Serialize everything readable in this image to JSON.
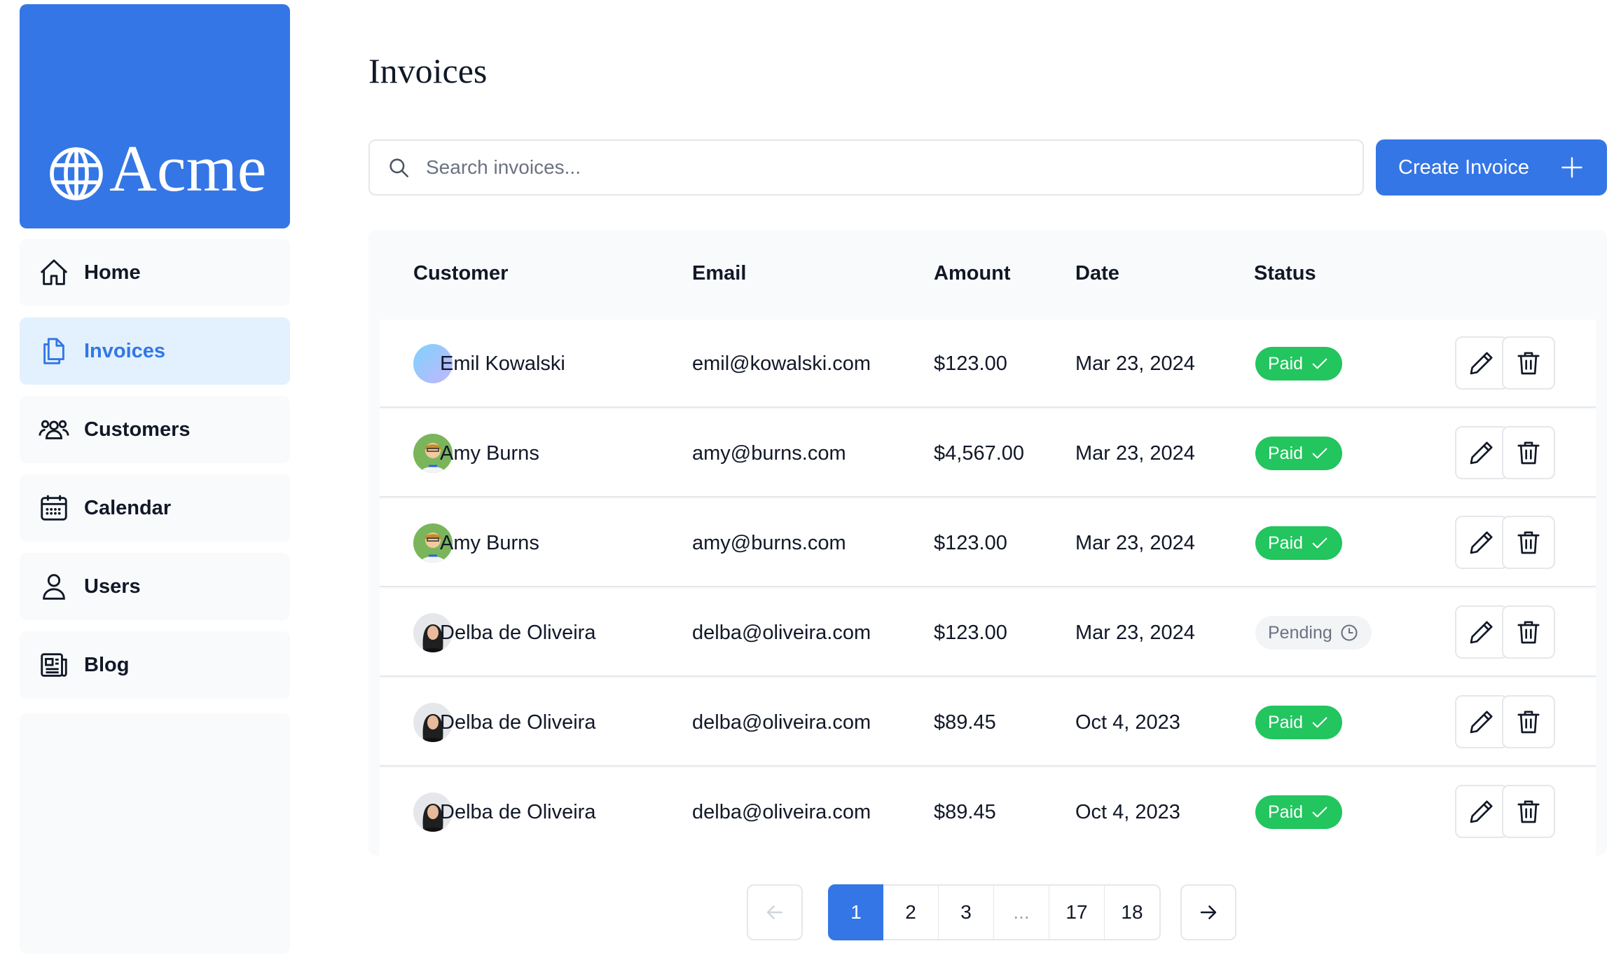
{
  "brand": {
    "name": "Acme"
  },
  "sidebar": {
    "items": [
      {
        "label": "Home",
        "icon": "home-icon",
        "active": false
      },
      {
        "label": "Invoices",
        "icon": "document-icon",
        "active": true
      },
      {
        "label": "Customers",
        "icon": "users-group-icon",
        "active": false
      },
      {
        "label": "Calendar",
        "icon": "calendar-icon",
        "active": false
      },
      {
        "label": "Users",
        "icon": "user-icon",
        "active": false
      },
      {
        "label": "Blog",
        "icon": "newspaper-icon",
        "active": false
      }
    ]
  },
  "page": {
    "title": "Invoices"
  },
  "search": {
    "placeholder": "Search invoices...",
    "value": ""
  },
  "create_button": {
    "label": "Create Invoice",
    "icon": "plus-icon"
  },
  "table": {
    "headers": {
      "customer": "Customer",
      "email": "Email",
      "amount": "Amount",
      "date": "Date",
      "status": "Status"
    },
    "rows": [
      {
        "customer": "Emil Kowalski",
        "email": "emil@kowalski.com",
        "amount": "$123.00",
        "date": "Mar 23, 2024",
        "status": "Paid"
      },
      {
        "customer": "Amy Burns",
        "email": "amy@burns.com",
        "amount": "$4,567.00",
        "date": "Mar 23, 2024",
        "status": "Paid"
      },
      {
        "customer": "Amy Burns",
        "email": "amy@burns.com",
        "amount": "$123.00",
        "date": "Mar 23, 2024",
        "status": "Paid"
      },
      {
        "customer": "Delba de Oliveira",
        "email": "delba@oliveira.com",
        "amount": "$123.00",
        "date": "Mar 23, 2024",
        "status": "Pending"
      },
      {
        "customer": "Delba de Oliveira",
        "email": "delba@oliveira.com",
        "amount": "$89.45",
        "date": "Oct 4, 2023",
        "status": "Paid"
      },
      {
        "customer": "Delba de Oliveira",
        "email": "delba@oliveira.com",
        "amount": "$89.45",
        "date": "Oct 4, 2023",
        "status": "Paid"
      }
    ]
  },
  "pagination": {
    "pages": [
      "1",
      "2",
      "3",
      "...",
      "17",
      "18"
    ],
    "current": "1"
  },
  "colors": {
    "accent": "#3476e6",
    "paid": "#22c55e",
    "active_bg": "#e2f1fd"
  }
}
